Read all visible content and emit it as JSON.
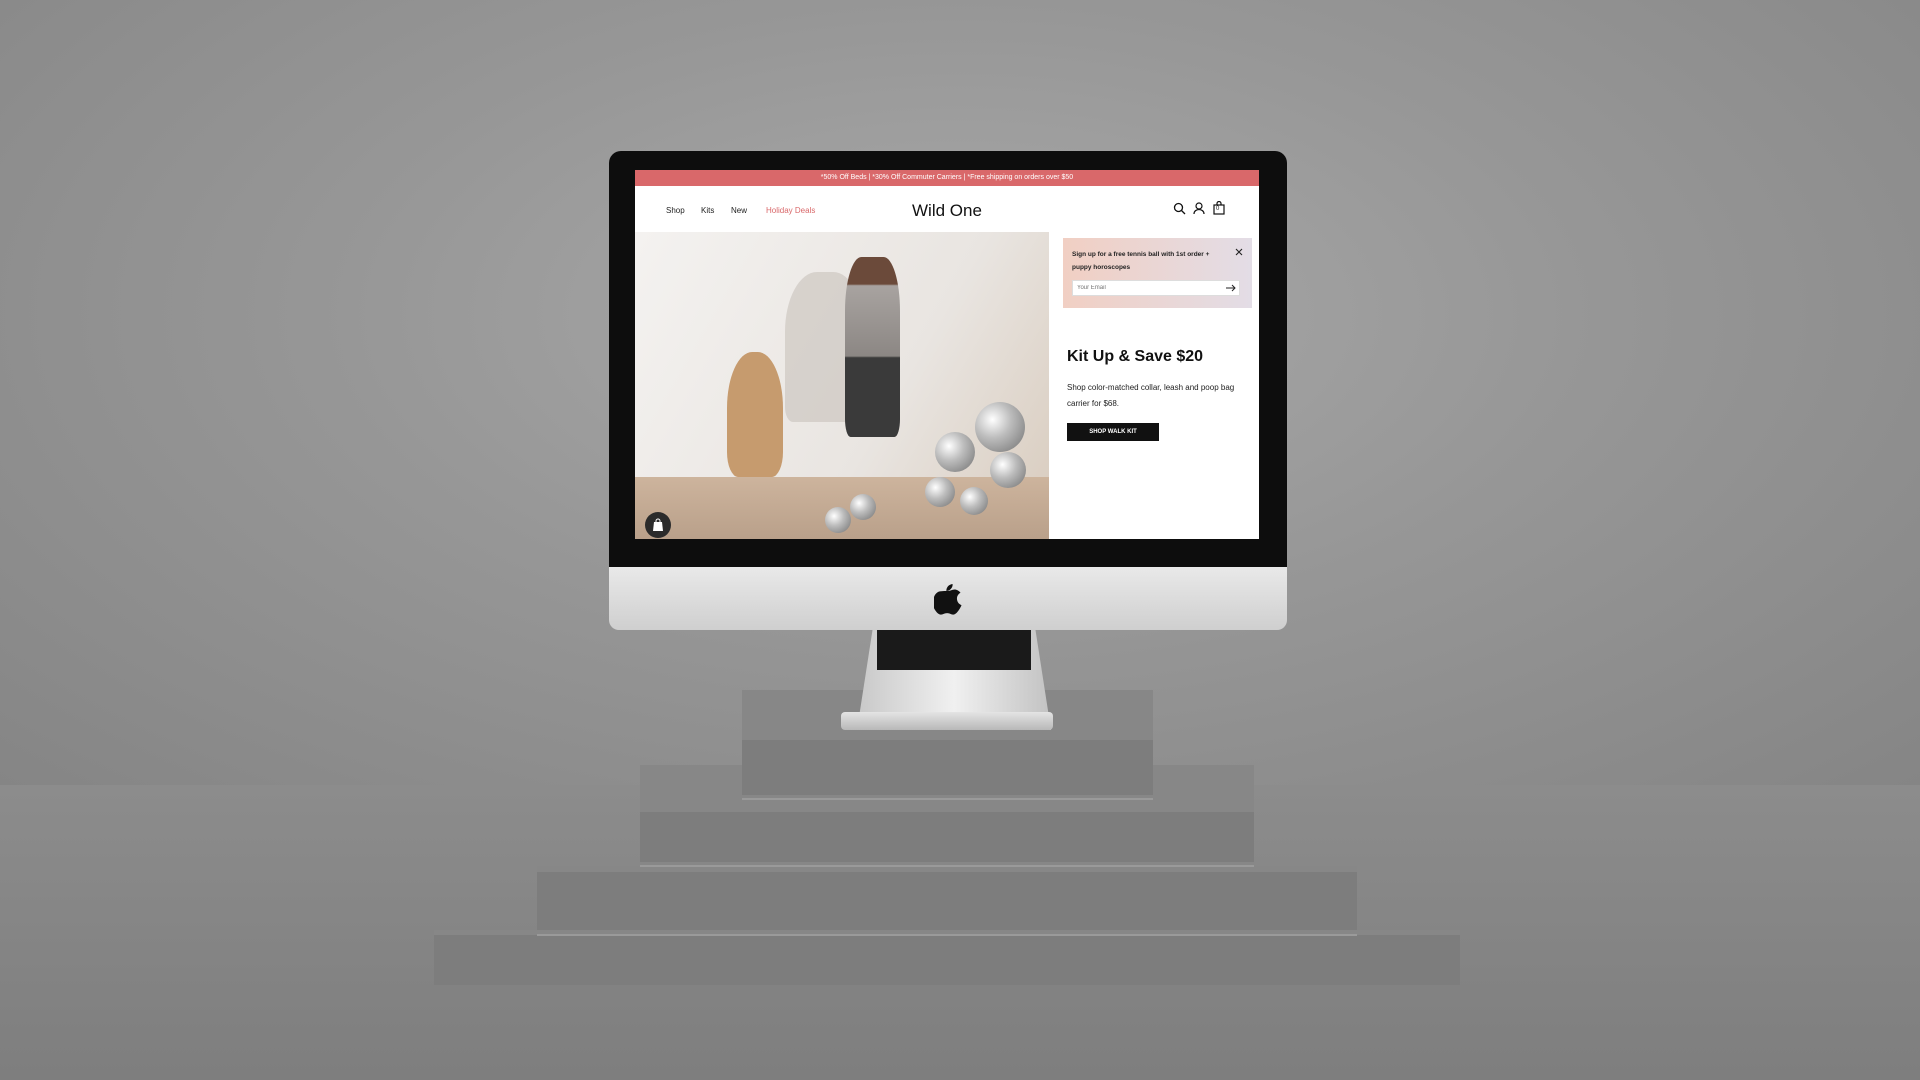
{
  "promo_bar": {
    "text": "*50% Off Beds | *30% Off Commuter Carriers | *Free shipping on orders over $50",
    "color": "#d9686a"
  },
  "nav": {
    "links": [
      {
        "label": "Shop"
      },
      {
        "label": "Kits"
      },
      {
        "label": "New"
      },
      {
        "label": "Holiday Deals",
        "color": "#d9686a"
      }
    ],
    "logo": "Wild One",
    "icons": [
      "search-icon",
      "account-icon",
      "cart-icon"
    ],
    "cart_count": "0"
  },
  "signup_popup": {
    "text": "Sign up for a free tennis ball with 1st order + puppy horoscopes",
    "email_placeholder": "Your Email",
    "close_icon": "close-icon",
    "submit_icon": "arrow-right-icon"
  },
  "hero": {
    "headline": "Kit Up & Save $20",
    "subtext": "Shop color-matched collar, leash and poop bag carrier for $68.",
    "cta_label": "SHOP WALK KIT"
  },
  "badges": [
    "shopify-bag-icon"
  ],
  "colors": {
    "accent": "#d9686a",
    "cta": "#111111",
    "popup_gradient": [
      "#f1cfc3",
      "#e3dde6"
    ]
  }
}
